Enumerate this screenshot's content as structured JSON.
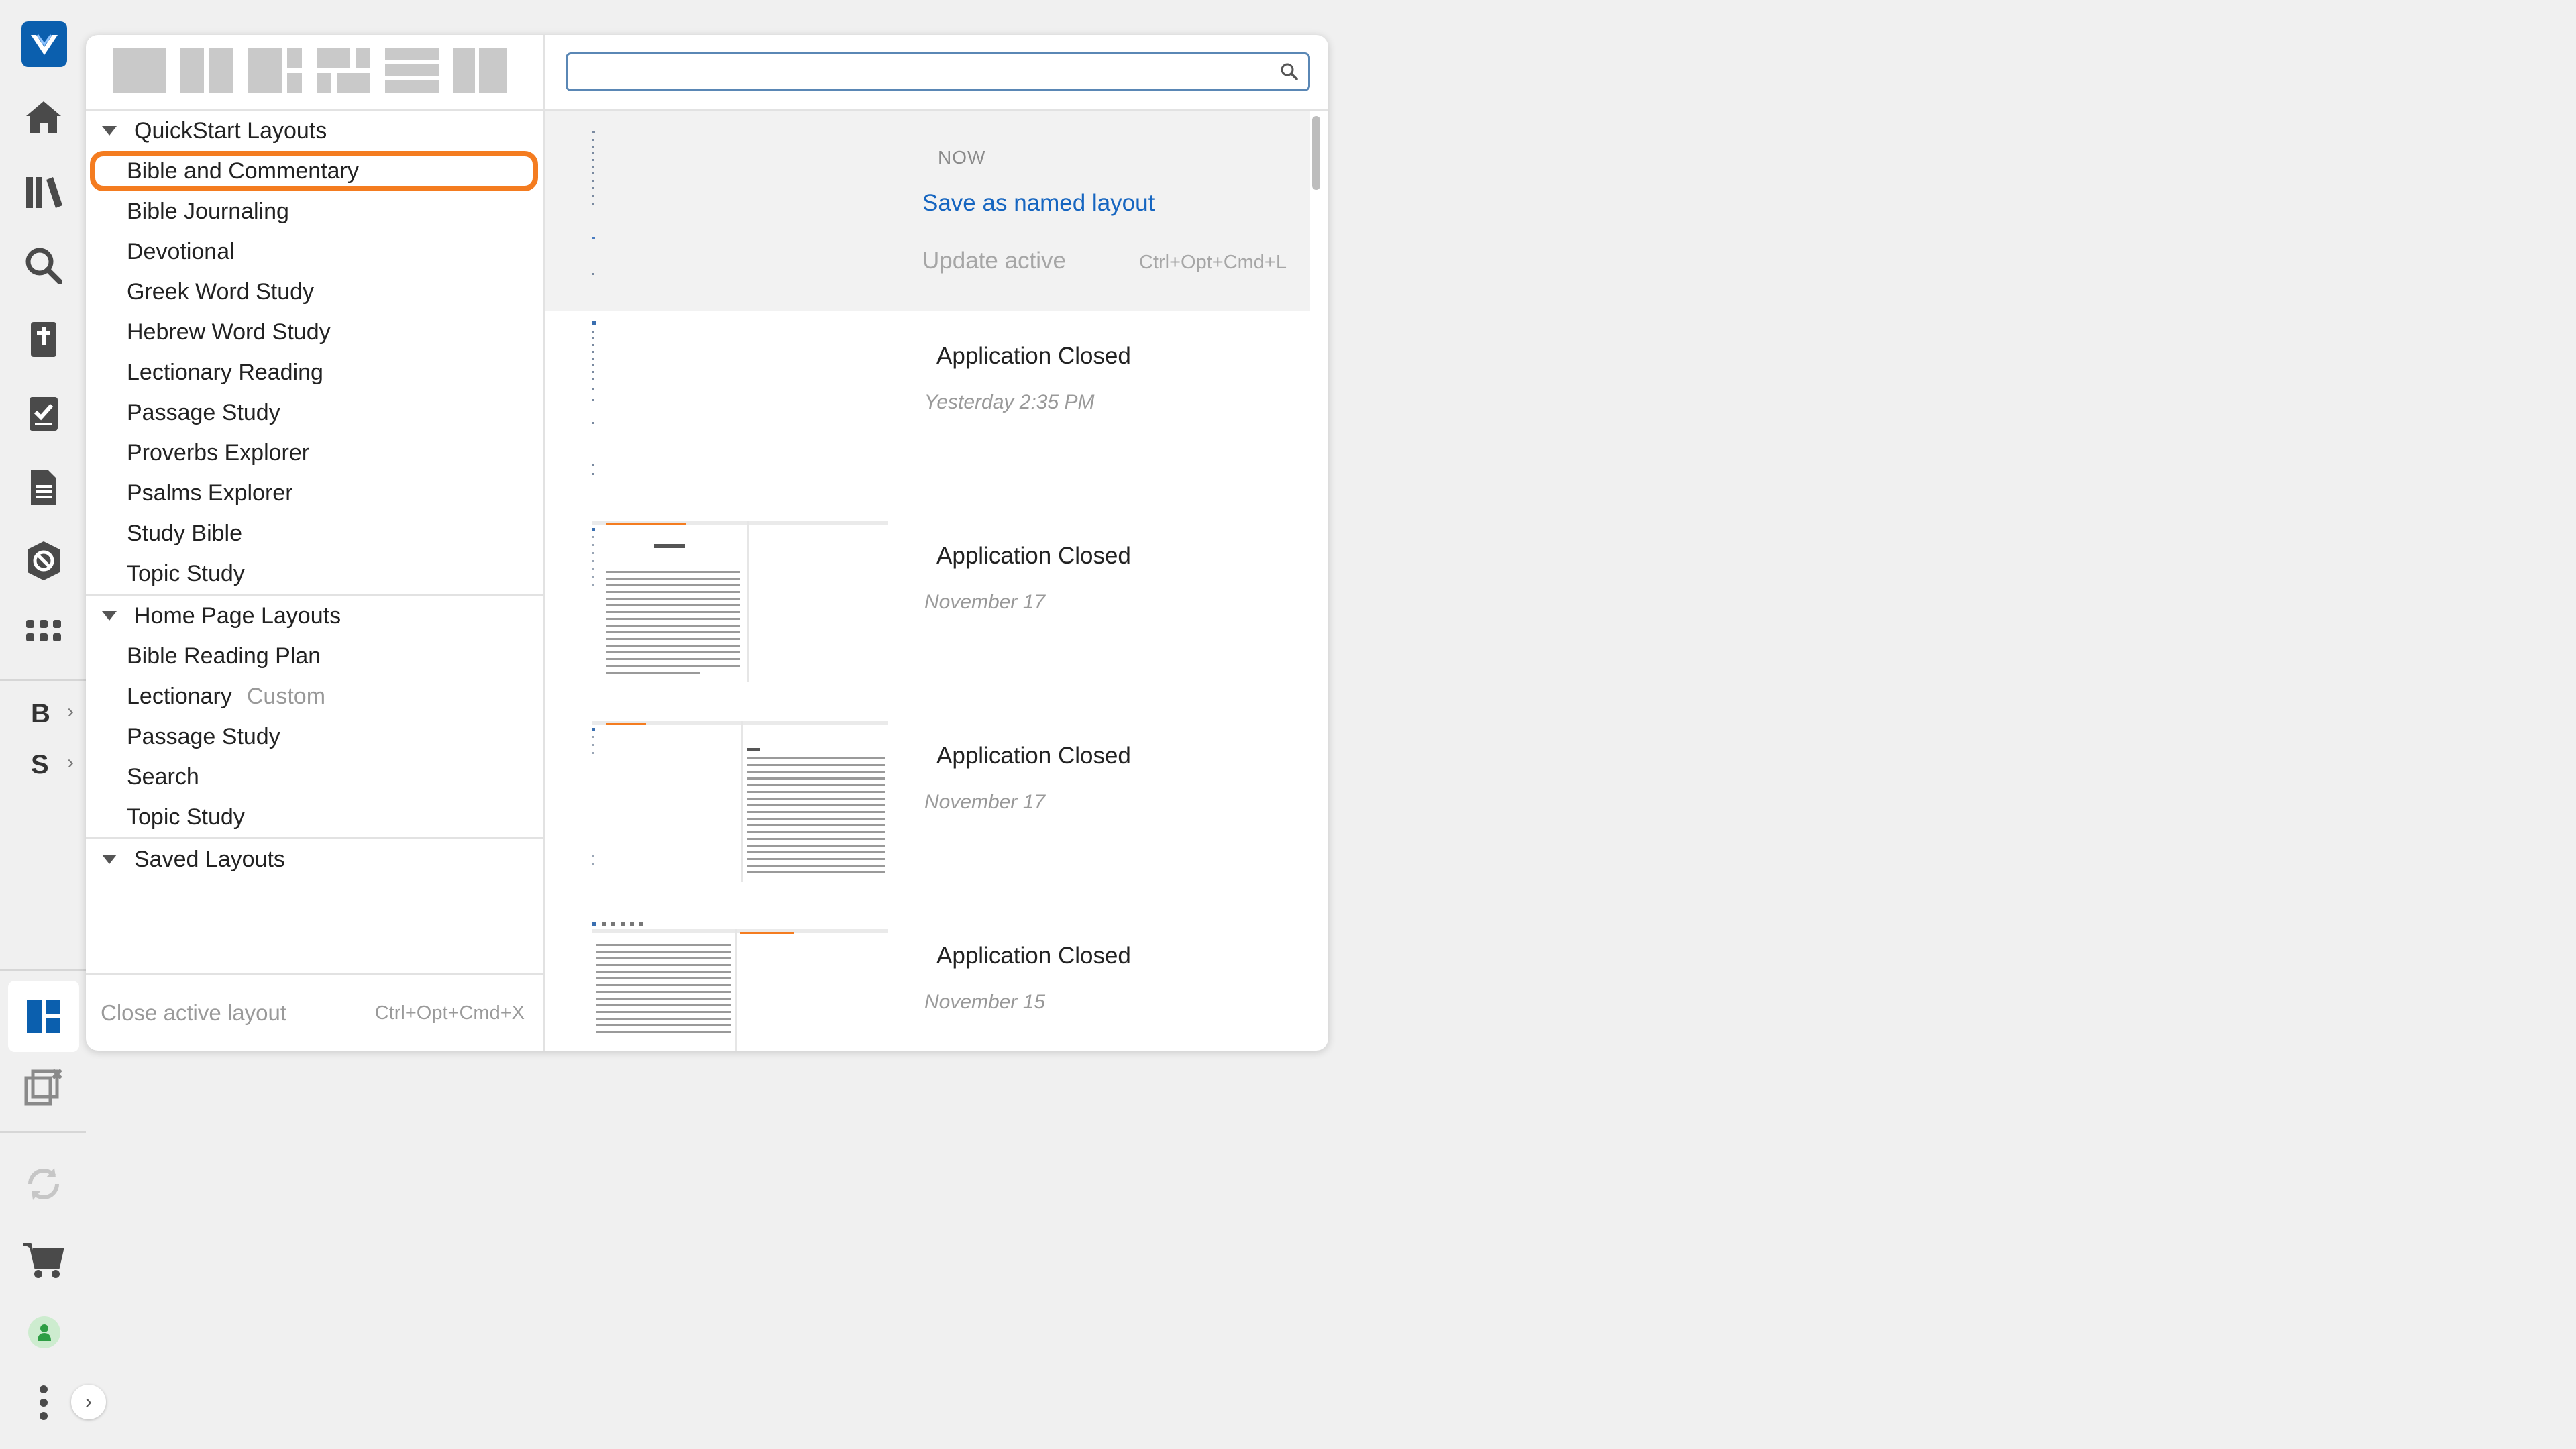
{
  "sidebar": {
    "letter_b": "B",
    "letter_s": "S",
    "icons": [
      "app-logo-icon",
      "home-icon",
      "library-icon",
      "search-icon",
      "bible-icon",
      "checklist-icon",
      "document-icon",
      "guide-icon",
      "apps-grid-icon",
      "layouts-icon",
      "close-layouts-icon",
      "sync-icon",
      "cart-icon",
      "user-icon",
      "more-icon"
    ],
    "accent_color": "#0b5fae"
  },
  "layouts_panel": {
    "groups": [
      {
        "label": "QuickStart Layouts",
        "items": [
          {
            "label": "Bible and Commentary"
          },
          {
            "label": "Bible Journaling"
          },
          {
            "label": "Devotional"
          },
          {
            "label": "Greek Word Study"
          },
          {
            "label": "Hebrew Word Study"
          },
          {
            "label": "Lectionary Reading"
          },
          {
            "label": "Passage Study"
          },
          {
            "label": "Proverbs Explorer"
          },
          {
            "label": "Psalms Explorer"
          },
          {
            "label": "Study Bible"
          },
          {
            "label": "Topic Study"
          }
        ]
      },
      {
        "label": "Home Page Layouts",
        "items": [
          {
            "label": "Bible Reading Plan"
          },
          {
            "label": "Lectionary",
            "badge": "Custom"
          },
          {
            "label": "Passage Study"
          },
          {
            "label": "Search"
          },
          {
            "label": "Topic Study"
          }
        ]
      },
      {
        "label": "Saved Layouts",
        "items": []
      }
    ],
    "footer": {
      "label": "Close active layout",
      "shortcut": "Ctrl+Opt+Cmd+X"
    },
    "highlight_color": "#f47c20"
  },
  "history": {
    "search_placeholder": "",
    "now": {
      "label": "NOW",
      "save_label": "Save as named layout",
      "update_label": "Update active",
      "update_shortcut": "Ctrl+Opt+Cmd+L"
    },
    "entries": [
      {
        "title": "Application Closed",
        "date": "Yesterday 2:35 PM"
      },
      {
        "title": "Application Closed",
        "date": "November 17"
      },
      {
        "title": "Application Closed",
        "date": "November 17"
      },
      {
        "title": "Application Closed",
        "date": "November 15"
      }
    ]
  }
}
